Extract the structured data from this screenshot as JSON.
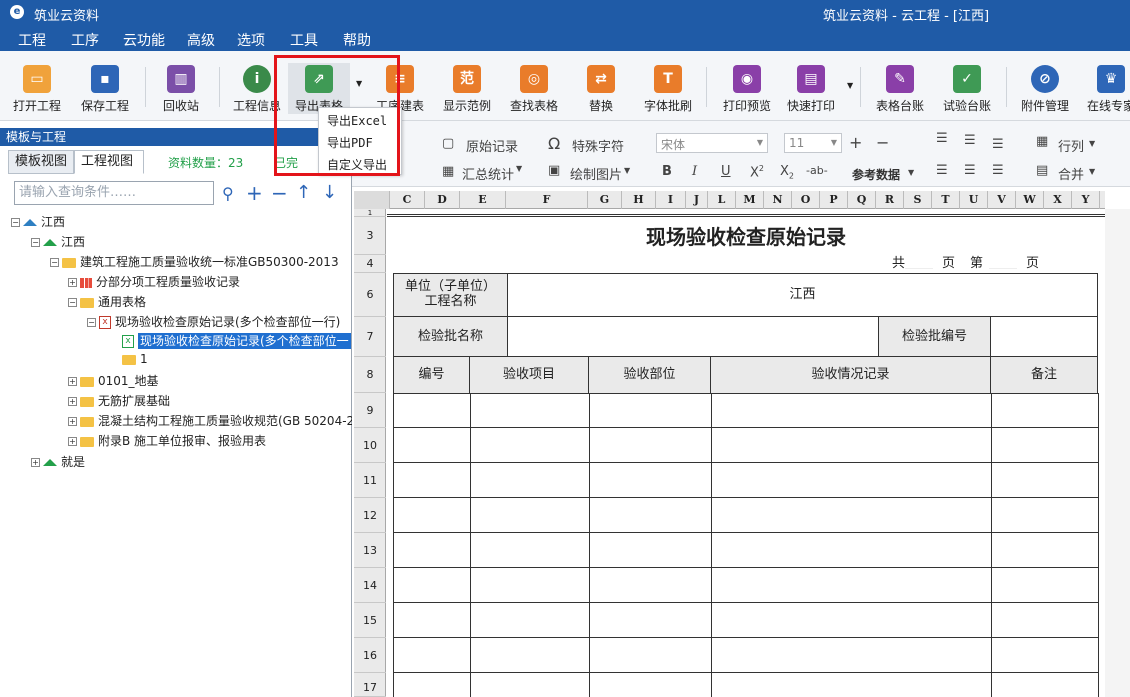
{
  "window": {
    "app_name": "筑业云资料",
    "title": "筑业云资料 - 云工程 - [江西]"
  },
  "menu": [
    "工程",
    "工序",
    "云功能",
    "高级",
    "选项",
    "工具",
    "帮助"
  ],
  "toolbar": [
    {
      "label": "打开工程",
      "icon": "folder-open-icon"
    },
    {
      "label": "保存工程",
      "icon": "save-icon"
    },
    {
      "label": "回收站",
      "icon": "trash-icon"
    },
    {
      "label": "工程信息",
      "icon": "info-icon"
    },
    {
      "label": "导出表格",
      "icon": "export-table-icon"
    },
    {
      "label": "工序建表",
      "icon": "layers-icon"
    },
    {
      "label": "显示范例",
      "icon": "example-icon"
    },
    {
      "label": "查找表格",
      "icon": "search-icon"
    },
    {
      "label": "替换",
      "icon": "replace-icon"
    },
    {
      "label": "字体批刷",
      "icon": "font-brush-icon"
    },
    {
      "label": "打印预览",
      "icon": "eye-icon"
    },
    {
      "label": "快速打印",
      "icon": "printer-icon"
    },
    {
      "label": "表格台账",
      "icon": "ledger-icon"
    },
    {
      "label": "试验台账",
      "icon": "test-ledger-icon"
    },
    {
      "label": "附件管理",
      "icon": "paperclip-icon"
    },
    {
      "label": "在线专家",
      "icon": "expert-icon"
    }
  ],
  "export_menu": [
    "导出Excel",
    "导出PDF",
    "自定义导出"
  ],
  "left_panel": {
    "header": "模板与工程",
    "tabs": [
      "模板视图",
      "工程视图"
    ],
    "count_label": "资料数量：23",
    "partial_label": "已完",
    "search_placeholder": "请输入查询条件……",
    "tree": [
      "江西",
      "江西",
      "建筑工程施工质量验收统一标准GB50300-2013",
      "分部分项工程质量验收记录",
      "通用表格",
      "现场验收检查原始记录(多个检查部位一行)",
      "现场验收检查原始记录(多个检查部位一",
      "1",
      "0101_地基",
      "无筋扩展基础",
      "混凝土结构工程施工质量验收规范(GB 50204-20",
      "附录B 施工单位报审、报验用表",
      "就是"
    ]
  },
  "ribbon": {
    "original_record": "原始记录",
    "summary_stats": "汇总统计",
    "special_char": "特殊字符",
    "draw_image": "绘制图片",
    "font_name": "宋体",
    "font_size": "11",
    "ref_data": "参考数据",
    "row_col": "行列",
    "merge": "合并",
    "bold": "B",
    "italic": "I",
    "underline": "U",
    "superscript": "X",
    "subscript": "X",
    "strike": "-ab-"
  },
  "sheet": {
    "columns": [
      "C",
      "D",
      "E",
      "F",
      "G",
      "H",
      "I",
      "J",
      "L",
      "M",
      "N",
      "O",
      "P",
      "Q",
      "R",
      "S",
      "T",
      "U",
      "V",
      "W",
      "X",
      "Y"
    ],
    "rows": [
      "1",
      "3",
      "4",
      "6",
      "7",
      "8",
      "9",
      "10",
      "11",
      "12",
      "13",
      "14",
      "15",
      "16",
      "17"
    ],
    "form_title": "现场验收检查原始记录",
    "page_total": "共",
    "page_unit1": "页",
    "page_num": "第",
    "page_unit2": "页",
    "unit_label": "单位（子单位）\n工程名称",
    "unit_value": "江西",
    "batch_name_label": "检验批名称",
    "batch_no_label": "检验批编号",
    "headers": [
      "编号",
      "验收项目",
      "验收部位",
      "验收情况记录",
      "备注"
    ]
  }
}
